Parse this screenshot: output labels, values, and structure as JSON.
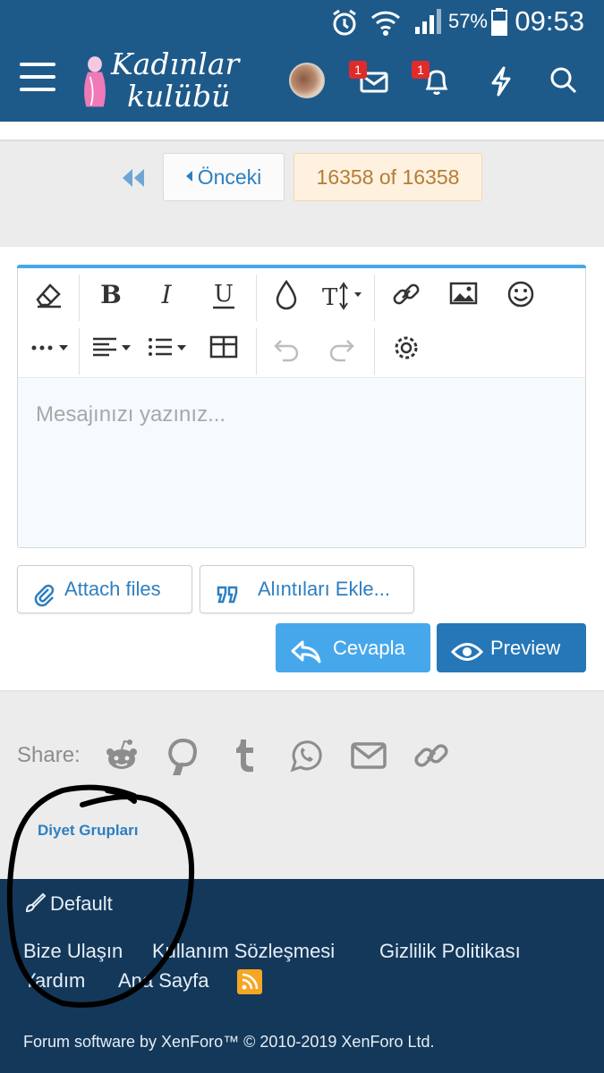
{
  "status_bar": {
    "time": "09:53",
    "battery_percent": "57%",
    "icons": [
      "alarm-icon",
      "wifi-icon",
      "signal-icon",
      "battery-icon"
    ]
  },
  "header": {
    "logo_text_line1": "Kadınlar",
    "logo_text_line2": "kulübü",
    "inbox_badge": "1",
    "alerts_badge": "1",
    "icons": [
      "menu-icon",
      "inbox-icon",
      "bell-icon",
      "lightning-icon",
      "search-icon"
    ]
  },
  "pagination": {
    "prev_label": "Önceki",
    "page_indicator": "16358 of 16358"
  },
  "editor": {
    "placeholder": "Mesajınızı yazınız...",
    "toolbar": [
      "eraser-icon",
      "bold-icon",
      "italic-icon",
      "underline-icon",
      "color-drop-icon",
      "font-size-icon",
      "link-icon",
      "image-icon",
      "emoji-icon",
      "more-icon",
      "align-icon",
      "list-icon",
      "table-icon",
      "undo-icon",
      "redo-icon",
      "settings-icon"
    ]
  },
  "buttons": {
    "attach_files": "Attach files",
    "insert_quotes": "Alıntıları Ekle...",
    "reply": "Cevapla",
    "preview": "Preview"
  },
  "share": {
    "label": "Share:",
    "icons": [
      "reddit-icon",
      "pinterest-icon",
      "tumblr-icon",
      "whatsapp-icon",
      "email-icon",
      "link-icon"
    ]
  },
  "breadcrumb": {
    "item": "Diyet Grupları"
  },
  "footer": {
    "style_chooser": "Default",
    "links": [
      "Bize Ulaşın",
      "Kullanım Sözleşmesi",
      "Gizlilik Politikası",
      "Yardım",
      "Ana Sayfa"
    ],
    "copyright": "Forum software by XenForo™ © 2010-2019 XenForo Ltd."
  },
  "colors": {
    "header_bg": "#1d5a8a",
    "footer_bg": "#14385a",
    "link": "#2d7fc1",
    "reply_btn": "#47a7eb",
    "preview_btn": "#2577b8",
    "badge": "#e12b2b"
  }
}
